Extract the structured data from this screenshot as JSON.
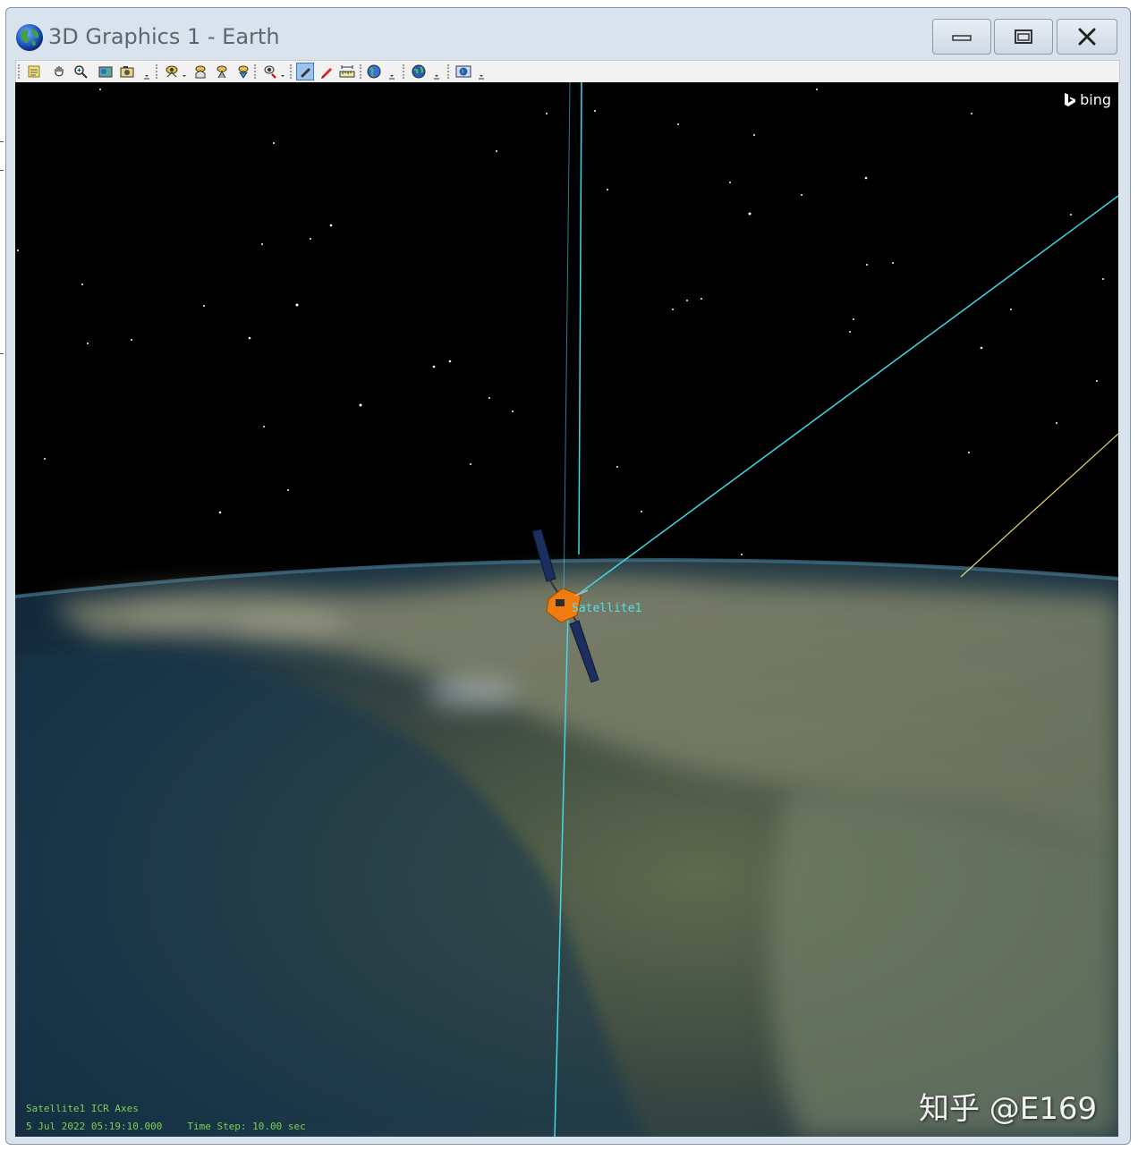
{
  "window": {
    "title": "3D Graphics 1 - Earth",
    "controls": [
      "minimize",
      "restore",
      "close"
    ]
  },
  "toolbar": {
    "icons": [
      "properties-icon",
      "pan-icon",
      "zoom-icon",
      "map-icon",
      "snapshot-icon",
      "view-from-icon",
      "home-view-icon",
      "view-to-icon",
      "north-up-icon",
      "camera-icon",
      "pencil-draw-icon",
      "red-pen-icon",
      "measure-icon",
      "globe-icon",
      "earth-data-icon",
      "globe-manager-icon"
    ],
    "active_icon": "pencil-draw-icon"
  },
  "viewport": {
    "attribution": "bing",
    "object_label": "Satellite1",
    "hud": {
      "axes_label": "Satellite1 ICR Axes",
      "date_time": "5 Jul 2022 05:19:10.000",
      "time_step": "Time Step: 10.00 sec"
    },
    "colors": {
      "axis_line": "#40d8e6",
      "orbit_line": "#e8d870",
      "hud_text": "#7ed04e",
      "satellite_body": "#f07c10",
      "solar_panel": "#1c2e5e"
    }
  },
  "watermark": "知乎 @E169"
}
